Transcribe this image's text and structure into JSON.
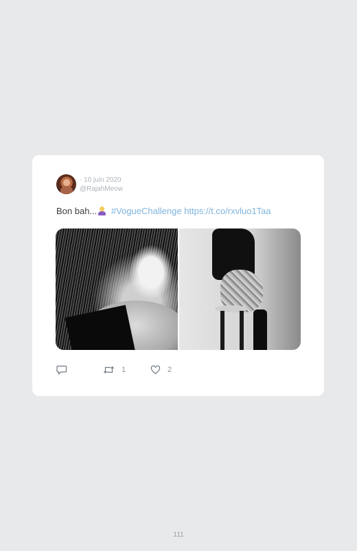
{
  "tweet": {
    "date": "· 10 juin 2020",
    "handle": "@RajahMeow",
    "text_prefix": "Bon bah...",
    "hashtag": "#VogueChallenge",
    "url": "https://t.co/rxvluo1Taa",
    "retweet_count": "1",
    "like_count": "2"
  },
  "icons": {
    "reply": "speech-bubble-icon",
    "retweet": "retweet-arrows-icon",
    "like": "heart-icon",
    "emoji": "woman-shrugging-emoji"
  },
  "colors": {
    "background": "#e8e9eb",
    "link": "#7fb4dc",
    "muted": "#aeb4ba"
  },
  "footer": {
    "page_number": "111"
  }
}
